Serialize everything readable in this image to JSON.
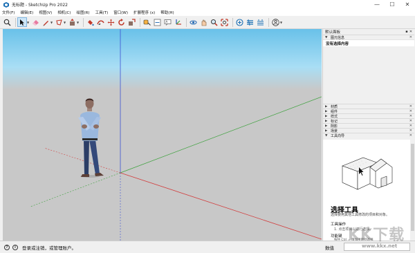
{
  "window": {
    "title": "无标题 - SketchUp Pro 2022",
    "controls": [
      "—",
      "☐",
      "✕"
    ]
  },
  "menu": {
    "items": [
      "文件(F)",
      "编辑(E)",
      "视图(V)",
      "相机(C)",
      "绘图(R)",
      "工具(T)",
      "窗口(W)",
      "扩展程序 (x)",
      "帮助(H)"
    ]
  },
  "toolbar": {
    "tools": [
      "search-icon",
      "select-icon",
      "eraser-icon",
      "pencil-icon",
      "shape-icon",
      "paint-bucket-icon",
      "push-pull-icon",
      "follow-me-icon",
      "move-icon",
      "rotate-icon",
      "scale-icon",
      "tape-measure-icon",
      "dimension-icon",
      "text-icon",
      "axes-icon",
      "orbit-icon",
      "pan-icon",
      "zoom-icon",
      "zoom-extents-icon",
      "warehouse-icon",
      "extension-warehouse-icon",
      "layout-icon",
      "account-icon"
    ]
  },
  "tray": {
    "title": "默认面板",
    "panels": {
      "entity_info": {
        "label": "图元信息",
        "body": "没有选择内容"
      },
      "materials": "材质",
      "components": "组件",
      "styles": "样式",
      "tags": "标记",
      "shadows": "阴影",
      "scenes": "场景",
      "instructor": "工具向导"
    },
    "instructor": {
      "heading": "选择工具",
      "description": "选择要用其他工具修改的项目和对象。",
      "operation_heading": "工具操作",
      "operation_desc": "1. 点击项目以进行选择。",
      "function_heading": "功能键",
      "function_desc": "按住 Ctrl = 增加项目到选择"
    }
  },
  "statusbar": {
    "message": "登录或注销，或管理账户。",
    "measurements_label": "数值",
    "info_icon": "i"
  },
  "watermark": {
    "text": "KK下载",
    "url": "www.kkx.net"
  },
  "colors": {
    "sky": "#69c1e9",
    "ground": "#c8c8c8",
    "axis_red": "#d23c3c",
    "axis_green": "#3fa23f",
    "axis_blue": "#3c50d2"
  }
}
